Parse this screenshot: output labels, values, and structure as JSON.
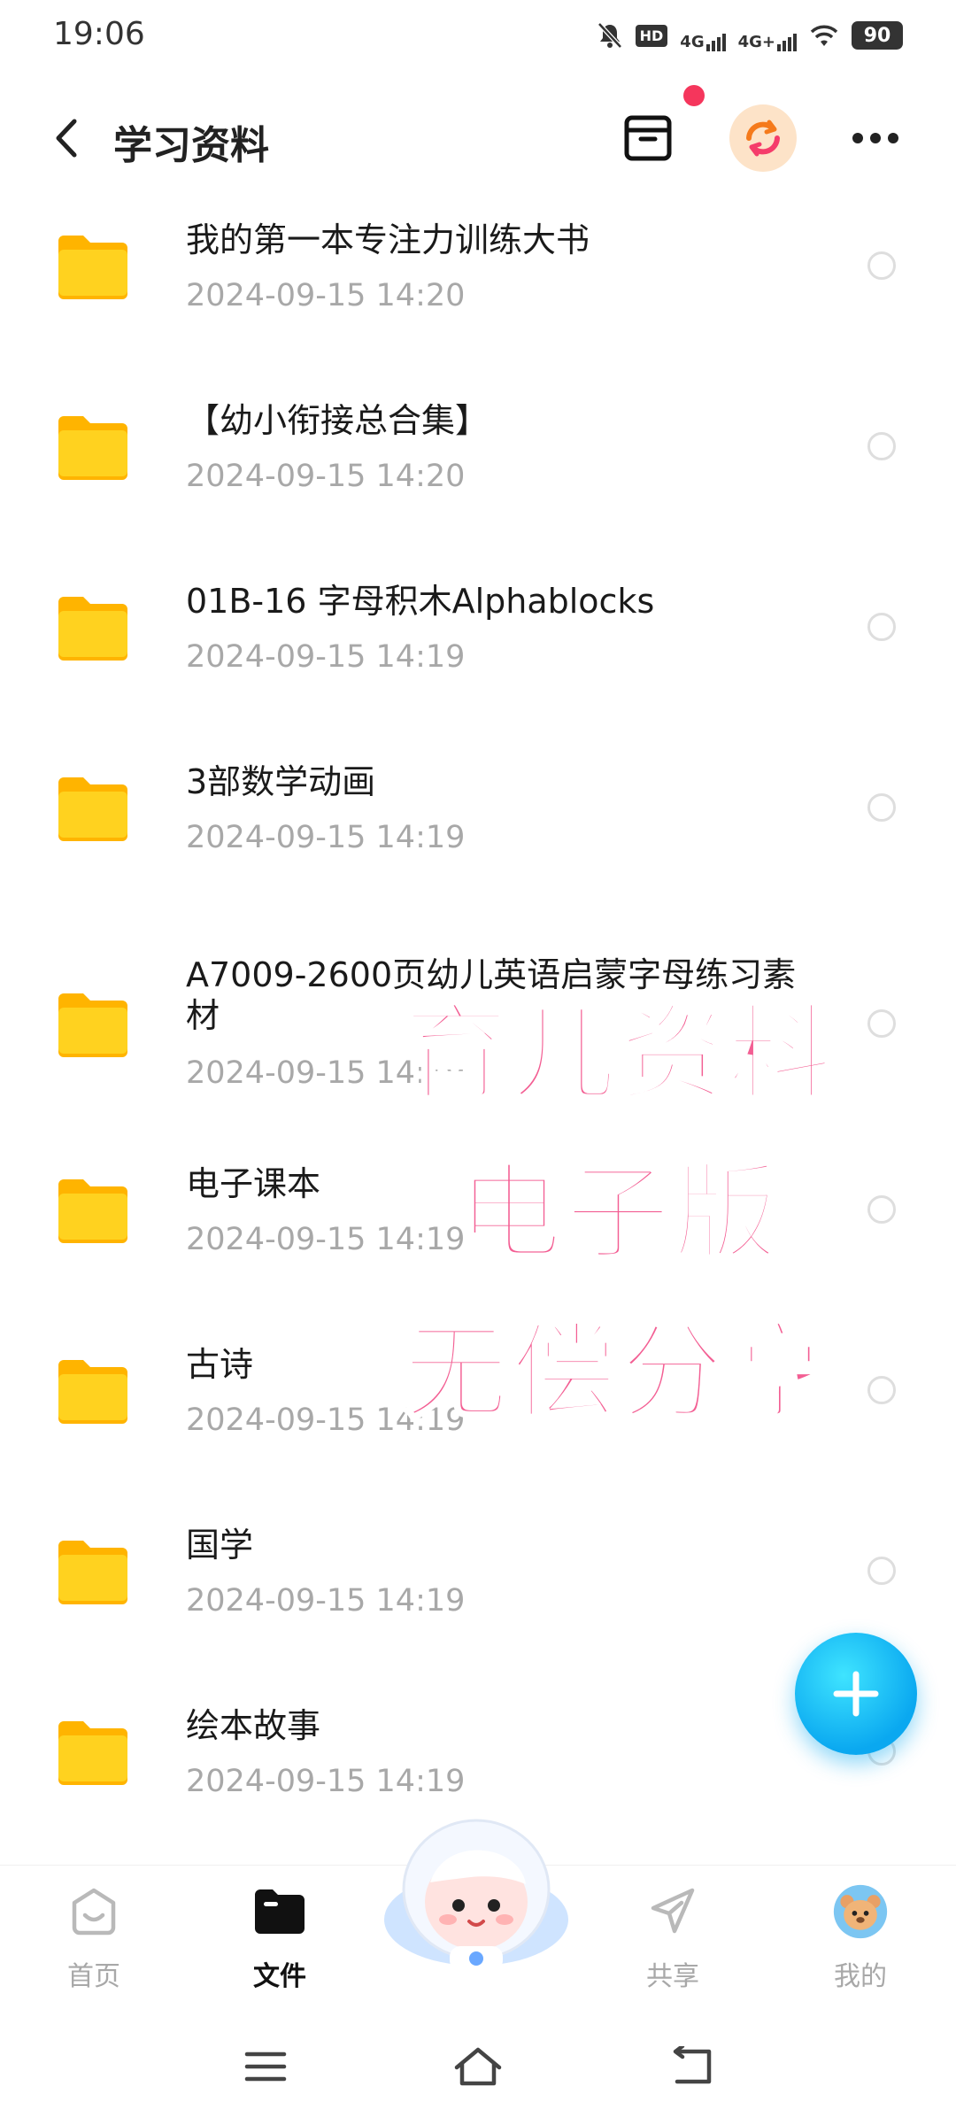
{
  "status_bar": {
    "time": "19:06",
    "hd_label": "HD",
    "network_1": "4G",
    "network_2": "4G+",
    "battery": "90"
  },
  "header": {
    "title": "学习资料"
  },
  "files": [
    {
      "name": "我的第一本专注力训练大书",
      "date": "2024-09-15  14:20"
    },
    {
      "name": "【幼小衔接总合集】",
      "date": "2024-09-15  14:20"
    },
    {
      "name": "01B-16 字母积木Alphablocks",
      "date": "2024-09-15  14:19"
    },
    {
      "name": "3部数学动画",
      "date": "2024-09-15  14:19"
    },
    {
      "name": "A7009-2600页幼儿英语启蒙字母练习素材",
      "date": "2024-09-15  14:19"
    },
    {
      "name": "电子课本",
      "date": "2024-09-15  14:19"
    },
    {
      "name": "古诗",
      "date": "2024-09-15  14:19"
    },
    {
      "name": "国学",
      "date": "2024-09-15  14:19"
    },
    {
      "name": "绘本故事",
      "date": "2024-09-15  14:19"
    }
  ],
  "watermark": {
    "line1": "育儿资料",
    "line2": "电子版",
    "line3": "无偿分享"
  },
  "bottom_nav": {
    "home": "首页",
    "files": "文件",
    "share": "共享",
    "me": "我的",
    "active": "files"
  },
  "colors": {
    "accent": "#0aa8f0",
    "folder": "#ffc81e",
    "watermark": "#f35e93",
    "badge": "#f5365c"
  }
}
